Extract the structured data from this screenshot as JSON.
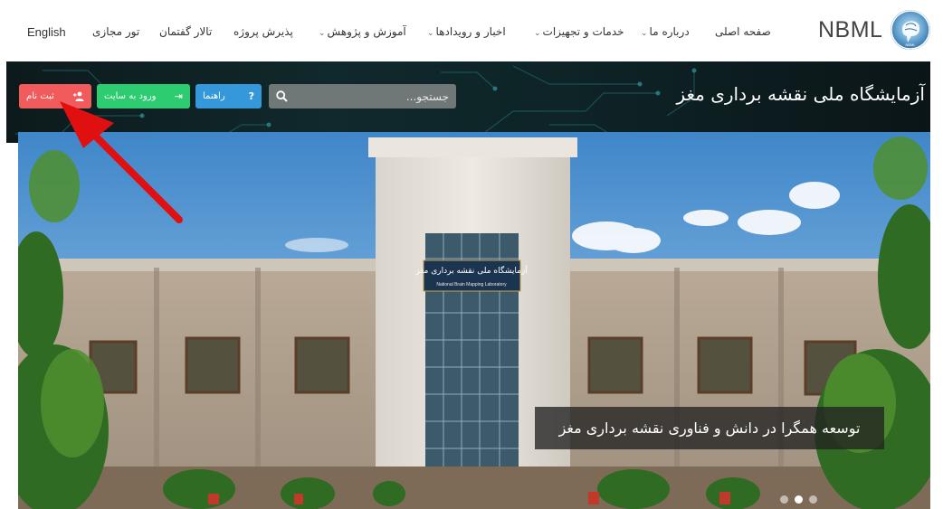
{
  "nav": {
    "home": "صفحه اصلی",
    "about": "درباره ما",
    "services": "خدمات و تجهیزات",
    "news": "اخبار و رویدادها",
    "education": "آموزش و پژوهش",
    "projects": "پذیرش پروژه",
    "forum": "تالار گفتمان",
    "tour": "تور مجازی",
    "language": "English"
  },
  "logo": {
    "text": "NBML",
    "emblem_text": "NBML"
  },
  "banner": {
    "title": "آزمایشگاه ملی نقشه برداری مغز"
  },
  "search": {
    "placeholder": "جستجو..."
  },
  "buttons": {
    "help": "راهنما",
    "login": "ورود به سایت",
    "register": "ثبت نام"
  },
  "hero": {
    "caption": "توسعه همگرا در دانش و فناوری نقشه برداری مغز",
    "sign_fa": "آزمایشگاه ملی نقشه برداری مغز",
    "sign_en": "National Brain Mapping Laboratory",
    "slides_total": 3,
    "slide_active": 2
  },
  "colors": {
    "banner_bg": "#0e2326",
    "register_btn": "#f25b5b",
    "login_btn": "#2ecc71",
    "help_btn": "#3498db",
    "search_bg": "#6f7777",
    "annotation_arrow": "#e01010"
  },
  "icons": [
    "brain-logo-icon",
    "chevron-down-icon",
    "search-icon",
    "question-icon",
    "sign-in-icon",
    "add-user-icon",
    "annotation-arrow"
  ]
}
